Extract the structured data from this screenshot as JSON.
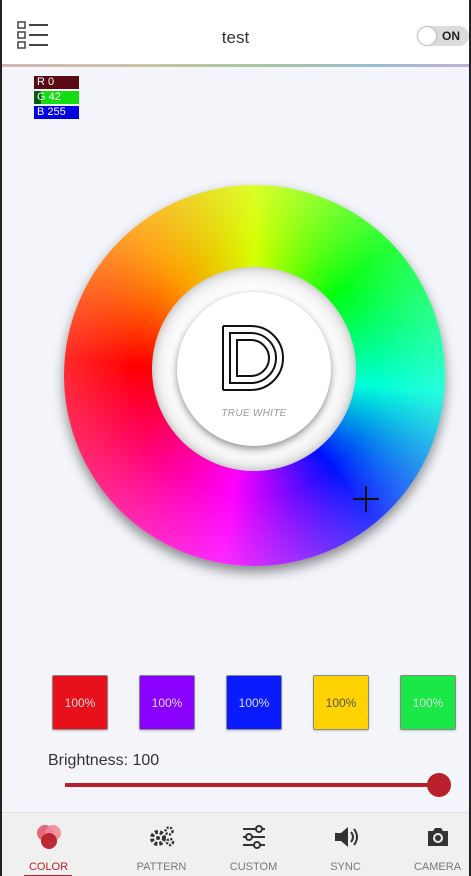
{
  "header": {
    "title": "test",
    "power_toggle_label": "ON",
    "menu_icon": "list-menu-icon"
  },
  "rgb": {
    "r_label": "R 0",
    "g_label": "G 42",
    "b_label": "B 255",
    "r": 0,
    "g": 42,
    "b": 255
  },
  "wheel": {
    "center_label": "TRUE WHITE",
    "logo_icon": "brand-d-logo"
  },
  "swatches": [
    {
      "label": "100%",
      "color": "#e8101a"
    },
    {
      "label": "100%",
      "color": "#8a00ff"
    },
    {
      "label": "100%",
      "color": "#0a1cff"
    },
    {
      "label": "100%",
      "color": "#ffd200"
    },
    {
      "label": "100%",
      "color": "#19e846"
    }
  ],
  "brightness": {
    "label": "Brightness: 100",
    "value": 100,
    "max": 100,
    "accent": "#b8202b"
  },
  "nav": {
    "tabs": [
      {
        "label": "COLOR",
        "icon": "color-circles-icon",
        "active": true
      },
      {
        "label": "PATTERN",
        "icon": "gears-icon"
      },
      {
        "label": "CUSTOM",
        "icon": "sliders-icon"
      },
      {
        "label": "SYNC",
        "icon": "speaker-icon"
      },
      {
        "label": "CAMERA",
        "icon": "camera-icon"
      }
    ]
  }
}
